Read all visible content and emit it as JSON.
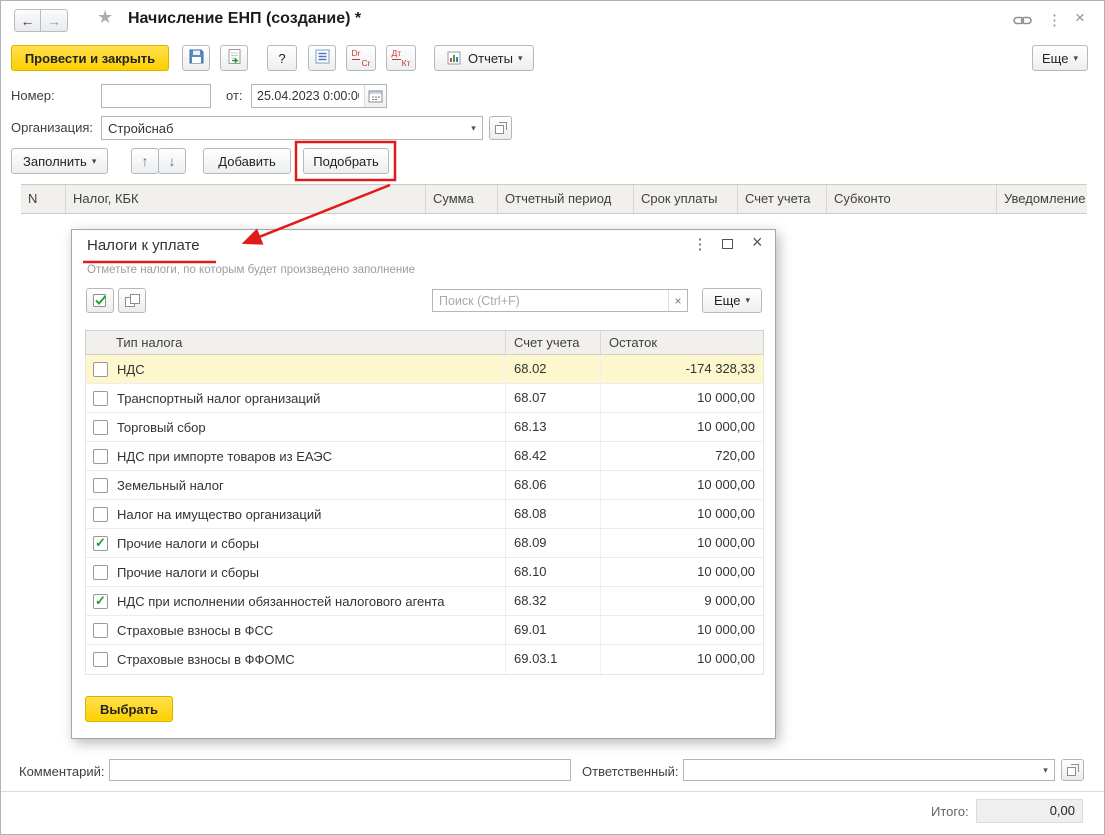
{
  "titlebar": {
    "title": "Начисление ЕНП (создание) *"
  },
  "icons": {
    "back": "←",
    "forward": "→",
    "star": "★",
    "kebab": "⋮",
    "close": "×",
    "dropdown": "▾",
    "up": "↑",
    "down": "↓",
    "clear": "×"
  },
  "toolbar": {
    "post_and_close": "Провести и закрыть",
    "help": "?",
    "dr": "Dr",
    "cr": "Cr",
    "dt": "Дт",
    "kt": "Кт",
    "reports": "Отчеты",
    "more": "Еще"
  },
  "fields": {
    "number_label": "Номер:",
    "number_value": "",
    "date_label": "от:",
    "date_value": "25.04.2023 0:00:00",
    "organization_label": "Организация:",
    "organization_value": "Стройснаб"
  },
  "actions": {
    "fill": "Заполнить",
    "add": "Добавить",
    "pick": "Подобрать"
  },
  "main_table": {
    "columns": [
      "N",
      "Налог, КБК",
      "Сумма",
      "Отчетный период",
      "Срок уплаты",
      "Счет учета",
      "Субконто",
      "Уведомление"
    ]
  },
  "dialog": {
    "title": "Налоги к уплате",
    "subtitle": "Отметьте налоги, по которым будет произведено заполнение",
    "search_placeholder": "Поиск (Ctrl+F)",
    "more": "Еще",
    "select": "Выбрать",
    "columns": [
      "Тип налога",
      "Счет учета",
      "Остаток"
    ],
    "rows": [
      {
        "checked": false,
        "highlighted": true,
        "name": "НДС",
        "account": "68.02",
        "balance": "-174 328,33"
      },
      {
        "checked": false,
        "highlighted": false,
        "name": "Транспортный налог организаций",
        "account": "68.07",
        "balance": "10 000,00"
      },
      {
        "checked": false,
        "highlighted": false,
        "name": "Торговый сбор",
        "account": "68.13",
        "balance": "10 000,00"
      },
      {
        "checked": false,
        "highlighted": false,
        "name": "НДС при импорте товаров из ЕАЭС",
        "account": "68.42",
        "balance": "720,00"
      },
      {
        "checked": false,
        "highlighted": false,
        "name": "Земельный налог",
        "account": "68.06",
        "balance": "10 000,00"
      },
      {
        "checked": false,
        "highlighted": false,
        "name": "Налог на имущество организаций",
        "account": "68.08",
        "balance": "10 000,00"
      },
      {
        "checked": true,
        "highlighted": false,
        "name": "Прочие налоги и сборы",
        "account": "68.09",
        "balance": "10 000,00"
      },
      {
        "checked": false,
        "highlighted": false,
        "name": "Прочие налоги и сборы",
        "account": "68.10",
        "balance": "10 000,00"
      },
      {
        "checked": true,
        "highlighted": false,
        "name": "НДС при исполнении обязанностей налогового агента",
        "account": "68.32",
        "balance": "9 000,00"
      },
      {
        "checked": false,
        "highlighted": false,
        "name": "Страховые взносы в ФСС",
        "account": "69.01",
        "balance": "10 000,00"
      },
      {
        "checked": false,
        "highlighted": false,
        "name": "Страховые взносы в ФФОМС",
        "account": "69.03.1",
        "balance": "10 000,00"
      }
    ]
  },
  "footer": {
    "comment_label": "Комментарий:",
    "comment_value": "",
    "responsible_label": "Ответственный:",
    "responsible_value": "",
    "total_label": "Итого:",
    "total_value": "0,00"
  },
  "colors": {
    "primary_button": "#fdd100",
    "annotation_red": "#e01b1b",
    "check_green": "#259b33",
    "highlight_row": "#fdf7cd"
  }
}
